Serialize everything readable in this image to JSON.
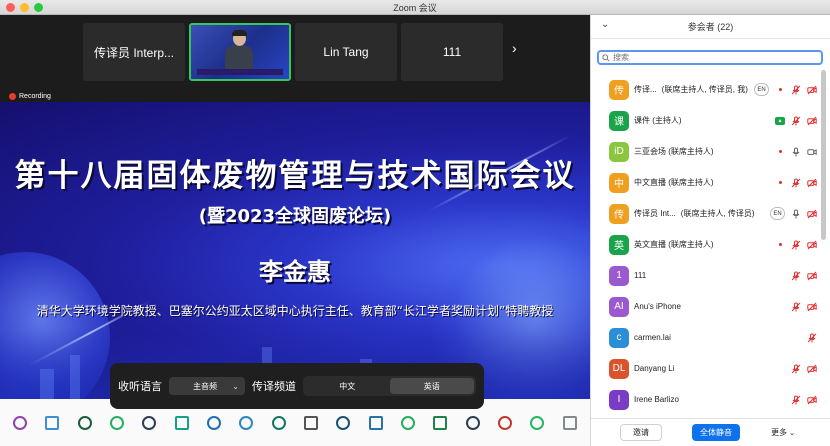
{
  "window": {
    "title": "Zoom 会议"
  },
  "thumbnails": [
    {
      "label": "传译员 Interp..."
    },
    {
      "label": ""
    },
    {
      "label": "Lin Tang"
    },
    {
      "label": "111"
    }
  ],
  "recording": {
    "label": "Recording"
  },
  "slide": {
    "title1": "第十八届固体废物管理与技术国际会议",
    "title2": "(暨2023全球固废论坛)",
    "name": "李金惠",
    "desc": "清华大学环境学院教授、巴塞尔公约亚太区域中心执行主任、教育部“长江学者奖励计划”特聘教授"
  },
  "interpretation": {
    "listen_label": "收听语言",
    "listen_value": "主音频",
    "channel_label": "传译频道",
    "channel_options": [
      "中文",
      "英语"
    ],
    "channel_selected": "英语"
  },
  "panel": {
    "title": "参会者 (22)",
    "search_placeholder": "搜索",
    "participants": [
      {
        "initial": "传",
        "color": "#f0a020",
        "name": "传译...",
        "role": "(联席主持人, 传译员, 我)",
        "lang": "EN",
        "rec": true,
        "share": false,
        "mic": "muted",
        "video": "off"
      },
      {
        "initial": "课",
        "color": "#1ba34a",
        "name": "课件 (主持人)",
        "role": "",
        "lang": "",
        "rec": false,
        "share": true,
        "mic": "muted",
        "video": "off"
      },
      {
        "initial": "iD",
        "color": "#8cc63f",
        "name": "三亚会场 (联席主持人)",
        "role": "",
        "lang": "",
        "rec": true,
        "share": false,
        "mic": "on",
        "video": "on"
      },
      {
        "initial": "中",
        "color": "#f0a020",
        "name": "中文直播 (联席主持人)",
        "role": "",
        "lang": "",
        "rec": true,
        "share": false,
        "mic": "muted",
        "video": "off"
      },
      {
        "initial": "传",
        "color": "#f0a020",
        "name": "传译员 Int...",
        "role": "(联席主持人, 传译员)",
        "lang": "EN",
        "rec": false,
        "share": false,
        "mic": "on",
        "video": "off"
      },
      {
        "initial": "英",
        "color": "#1ba34a",
        "name": "英文直播 (联席主持人)",
        "role": "",
        "lang": "",
        "rec": true,
        "share": false,
        "mic": "muted",
        "video": "off"
      },
      {
        "initial": "1",
        "color": "#9b59d0",
        "name": "111",
        "role": "",
        "lang": "",
        "rec": false,
        "share": false,
        "mic": "muted",
        "video": "off"
      },
      {
        "initial": "AI",
        "color": "#9b59d0",
        "name": "Anu's iPhone",
        "role": "",
        "lang": "",
        "rec": false,
        "share": false,
        "mic": "muted",
        "video": "off"
      },
      {
        "initial": "c",
        "color": "#2a8fd6",
        "name": "carmen.lai",
        "role": "",
        "lang": "",
        "rec": false,
        "share": false,
        "mic": "muted",
        "video": "none"
      },
      {
        "initial": "DL",
        "color": "#d9542c",
        "name": "Danyang Li",
        "role": "",
        "lang": "",
        "rec": false,
        "share": false,
        "mic": "muted",
        "video": "off"
      },
      {
        "initial": "I",
        "color": "#7a3cc4",
        "name": "Irene Barlizo",
        "role": "",
        "lang": "",
        "rec": false,
        "share": false,
        "mic": "muted",
        "video": "off"
      }
    ],
    "footer": {
      "invite": "邀请",
      "mute_all": "全体静音",
      "more": "更多"
    }
  },
  "colors": {
    "accent": "#0e72ed",
    "muted_red": "#e03131",
    "active_tile": "#34c759"
  }
}
